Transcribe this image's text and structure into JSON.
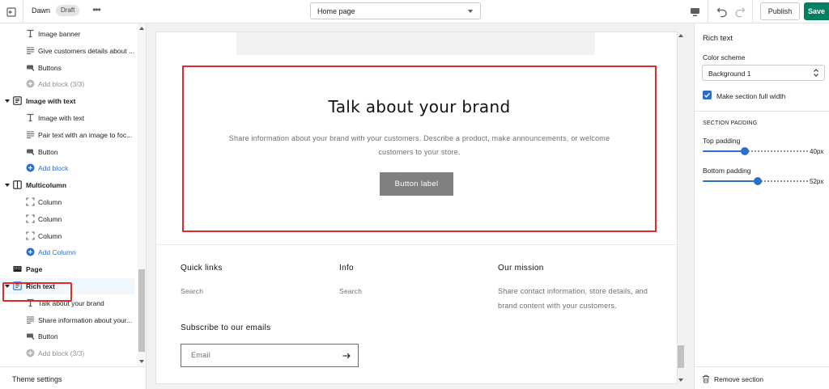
{
  "topbar": {
    "theme_name": "Dawn",
    "status_badge": "Draft",
    "more_label": "•••",
    "page_select_value": "Home page",
    "publish_label": "Publish",
    "save_label": "Save"
  },
  "sidebar": {
    "items": [
      {
        "kind": "child",
        "icon": "text-icon",
        "label": "Image banner"
      },
      {
        "kind": "child",
        "icon": "paragraph-icon",
        "label": "Give customers details about ..."
      },
      {
        "kind": "child",
        "icon": "button-icon",
        "label": "Buttons"
      },
      {
        "kind": "add-disabled",
        "icon": "add-circle-icon",
        "label": "Add block (3/3)"
      },
      {
        "kind": "section",
        "icon": "image-with-text-icon",
        "label": "Image with text"
      },
      {
        "kind": "child",
        "icon": "text-icon",
        "label": "Image with text"
      },
      {
        "kind": "child",
        "icon": "paragraph-icon",
        "label": "Pair text with an image to foc..."
      },
      {
        "kind": "child",
        "icon": "button-icon",
        "label": "Button"
      },
      {
        "kind": "add",
        "icon": "add-circle-icon",
        "label": "Add block"
      },
      {
        "kind": "section",
        "icon": "columns-icon",
        "label": "Multicolumn"
      },
      {
        "kind": "child",
        "icon": "column-icon",
        "label": "Column"
      },
      {
        "kind": "child",
        "icon": "column-icon",
        "label": "Column"
      },
      {
        "kind": "child",
        "icon": "column-icon",
        "label": "Column"
      },
      {
        "kind": "add",
        "icon": "add-circle-icon",
        "label": "Add Column"
      },
      {
        "kind": "page",
        "icon": "page-icon",
        "label": "Page"
      },
      {
        "kind": "section-selected",
        "icon": "rich-text-icon",
        "label": "Rich text"
      },
      {
        "kind": "child",
        "icon": "text-icon",
        "label": "Talk about your brand"
      },
      {
        "kind": "child",
        "icon": "paragraph-icon",
        "label": "Share information about your..."
      },
      {
        "kind": "child",
        "icon": "button-icon",
        "label": "Button"
      },
      {
        "kind": "add-disabled",
        "icon": "add-circle-icon",
        "label": "Add block (3/3)"
      }
    ],
    "theme_settings_label": "Theme settings"
  },
  "preview": {
    "rich_text": {
      "heading": "Talk about your brand",
      "body": "Share information about your brand with your customers. Describe a product, make announcements, or welcome customers to your store.",
      "button_label": "Button label"
    },
    "footer": {
      "quick_links_heading": "Quick links",
      "quick_links_item": "Search",
      "info_heading": "Info",
      "info_item": "Search",
      "mission_heading": "Our mission",
      "mission_text": "Share contact information, store details, and brand content with your customers.",
      "subscribe_heading": "Subscribe to our emails",
      "email_placeholder": "Email"
    }
  },
  "settings_panel": {
    "title": "Rich text",
    "color_scheme_label": "Color scheme",
    "color_scheme_value": "Background 1",
    "full_width_label": "Make section full width",
    "full_width_checked": true,
    "section_padding_caption": "SECTION PADDING",
    "top_padding_label": "Top padding",
    "top_padding_value": "40px",
    "top_padding_fraction": 0.4,
    "bottom_padding_label": "Bottom padding",
    "bottom_padding_value": "52px",
    "bottom_padding_fraction": 0.52,
    "remove_section_label": "Remove section"
  },
  "colors": {
    "accent_blue": "#2c6ecb",
    "save_green": "#008060",
    "highlight_red": "#e22a2a"
  }
}
